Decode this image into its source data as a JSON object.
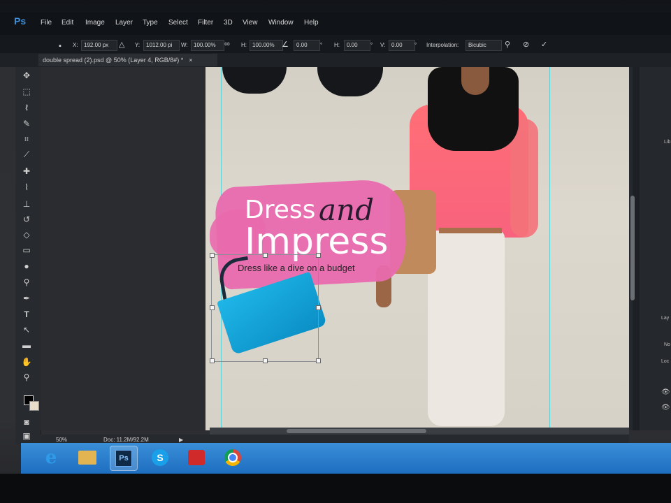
{
  "app": {
    "logo": "Ps"
  },
  "menu": [
    "File",
    "Edit",
    "Image",
    "Layer",
    "Type",
    "Select",
    "Filter",
    "3D",
    "View",
    "Window",
    "Help"
  ],
  "options": {
    "x_label": "X:",
    "x_value": "192.00 px",
    "y_label": "Y:",
    "y_value": "1012.00 pi",
    "w_label": "W:",
    "w_value": "100.00%",
    "h_label": "H:",
    "h_value": "100.00%",
    "angle_value": "0.00",
    "hskew_label": "H:",
    "hskew_value": "0.00",
    "vskew_label": "V:",
    "vskew_value": "0.00",
    "interp_label": "Interpolation:",
    "interp_value": "Bicubic"
  },
  "document_tab": "double spread (2).psd @ 50% (Layer 4, RGB/8#) *",
  "artwork": {
    "title_word1": "Dress",
    "title_word2": "and",
    "title_word3": "Impress",
    "subtitle": "Dress like a dive on a budget"
  },
  "status": {
    "zoom": "50%",
    "doc": "Doc: 11.2M/92.2M"
  },
  "taskbar": [
    {
      "name": "internet-explorer-icon",
      "label": "e",
      "color": "#2f9be8"
    },
    {
      "name": "file-explorer-icon",
      "label": "",
      "color": "#e3b552"
    },
    {
      "name": "photoshop-icon",
      "label": "Ps",
      "color": "#0e2a46"
    },
    {
      "name": "skype-icon",
      "label": "S",
      "color": "#1aa0e8"
    },
    {
      "name": "creative-cloud-icon",
      "label": "",
      "color": "#d12a2a"
    },
    {
      "name": "chrome-icon",
      "label": "",
      "color": "#e6e6e6"
    }
  ],
  "right_panel": {
    "labels": [
      "Lib",
      "Lay",
      "Loc",
      "No"
    ]
  }
}
